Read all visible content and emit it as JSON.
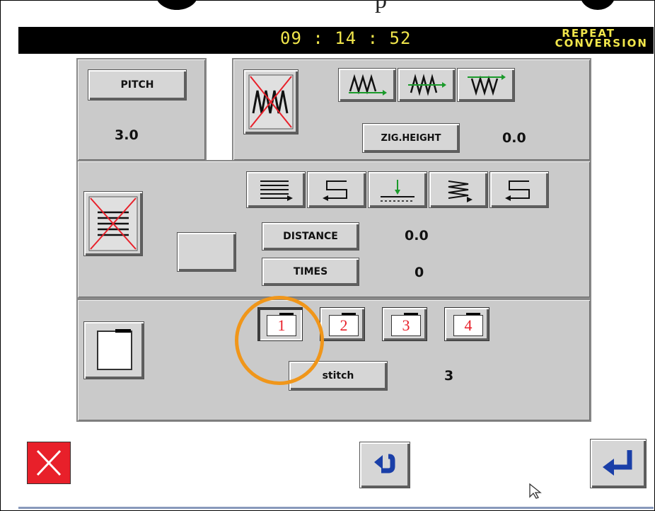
{
  "title_bar": {
    "clock": "09 : 14 : 52",
    "mode_line1": "REPEAT",
    "mode_line2": "CONVERSION"
  },
  "top_clip_text": "p",
  "pitch": {
    "button_label": "PITCH",
    "value": "3.0"
  },
  "zigzag": {
    "height_label": "ZIG.HEIGHT",
    "height_value": "0.0"
  },
  "repeat": {
    "distance_label": "DISTANCE",
    "distance_value": "0.0",
    "times_label": "TIMES",
    "times_value": "0"
  },
  "bottom_panel": {
    "numbers": [
      "1",
      "2",
      "3",
      "4"
    ],
    "selected": "1",
    "stitch_label": "stitch",
    "stitch_value": "3"
  },
  "colors": {
    "title_text": "#f1e64b",
    "panel": "#cacaca",
    "number": "#e8202a",
    "highlight_ring": "#f0961a",
    "cancel_red": "#e8202a",
    "nav_blue": "#1a3fa8"
  }
}
